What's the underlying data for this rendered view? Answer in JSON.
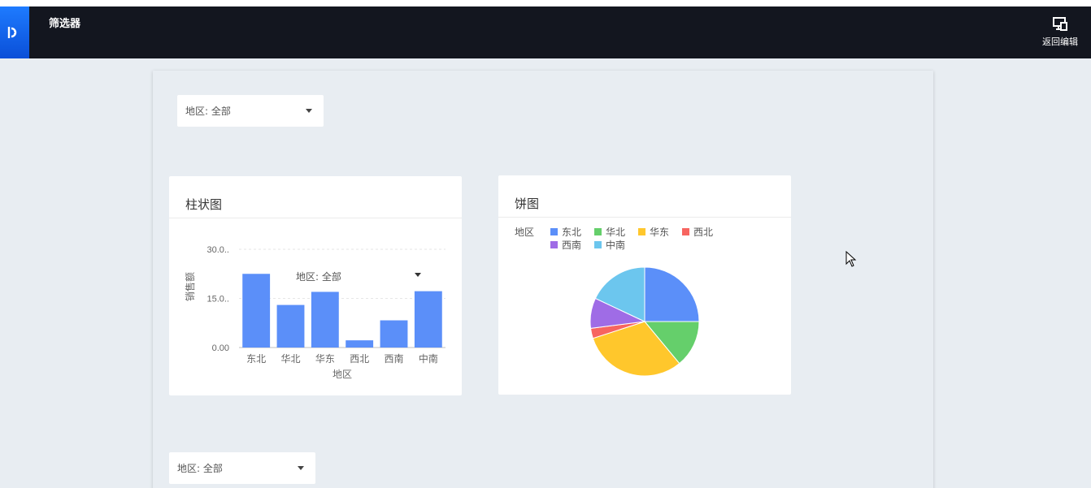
{
  "app": {
    "title": "筛选器",
    "back_label": "返回编辑"
  },
  "filters": {
    "top": "地区: 全部",
    "chart_overlay": "地区: 全部",
    "bottom": "地区: 全部"
  },
  "bar_card": {
    "title": "柱状图"
  },
  "pie_card": {
    "title": "饼图"
  },
  "chart_data": [
    {
      "type": "bar",
      "title": "柱状图",
      "categories": [
        "东北",
        "华北",
        "华东",
        "西北",
        "西南",
        "中南"
      ],
      "values": [
        22.5,
        13,
        17,
        2.2,
        8.3,
        17.2
      ],
      "xlabel": "地区",
      "ylabel": "销售额",
      "yticks": [
        "30.0..",
        "15.0..",
        "0.00"
      ],
      "ylim": [
        0,
        30
      ],
      "grid": true,
      "color": "#5b8ff9"
    },
    {
      "type": "pie",
      "title": "饼图",
      "legend_title": "地区",
      "legend_position": "top-left",
      "categories": [
        "东北",
        "华北",
        "华东",
        "西北",
        "西南",
        "中南"
      ],
      "values": [
        25,
        14,
        31,
        3,
        9,
        18
      ],
      "colors": [
        "#5b8ff9",
        "#65cf6b",
        "#ffc72c",
        "#f76560",
        "#9f6ce6",
        "#6cc6ee"
      ]
    }
  ]
}
